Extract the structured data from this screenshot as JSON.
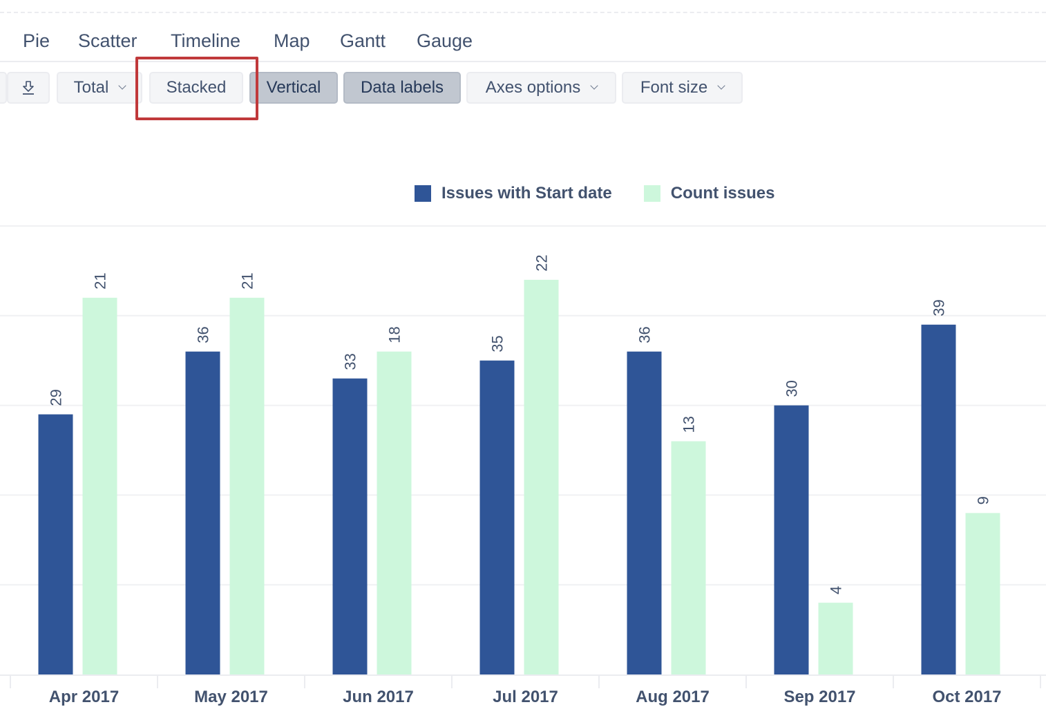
{
  "chart_types": {
    "tabs": [
      {
        "label": "Pie"
      },
      {
        "label": "Scatter"
      },
      {
        "label": "Timeline"
      },
      {
        "label": "Map"
      },
      {
        "label": "Gantt"
      },
      {
        "label": "Gauge"
      }
    ]
  },
  "toolbar": {
    "download_icon": "download-icon",
    "total_label": "Total",
    "stacked_label": "Stacked",
    "vertical_label": "Vertical",
    "data_labels_label": "Data labels",
    "axes_options_label": "Axes options",
    "font_size_label": "Font size",
    "active": [
      "Vertical",
      "Data labels"
    ],
    "highlighted": "Stacked",
    "highlight_color": "#c0393b"
  },
  "chart_data": {
    "type": "bar",
    "title": "",
    "xlabel": "",
    "ylabel": "",
    "categories": [
      "Apr 2017",
      "May 2017",
      "Jun 2017",
      "Jul 2017",
      "Aug 2017",
      "Sep 2017",
      "Oct 2017"
    ],
    "series": [
      {
        "name": "Issues with Start date",
        "color": "#2f5597",
        "axis": "left",
        "values": [
          29,
          36,
          33,
          35,
          36,
          30,
          39
        ]
      },
      {
        "name": "Count issues",
        "color": "#cdf7dc",
        "axis": "right",
        "values": [
          21,
          21,
          18,
          22,
          13,
          4,
          9
        ]
      }
    ],
    "ylim_left": [
      0,
      50
    ],
    "ylim_right": [
      0,
      25
    ],
    "gridlines": 5,
    "grid": true,
    "data_labels": true,
    "legend_position": "top-center",
    "stacked": false,
    "orientation": "vertical"
  }
}
